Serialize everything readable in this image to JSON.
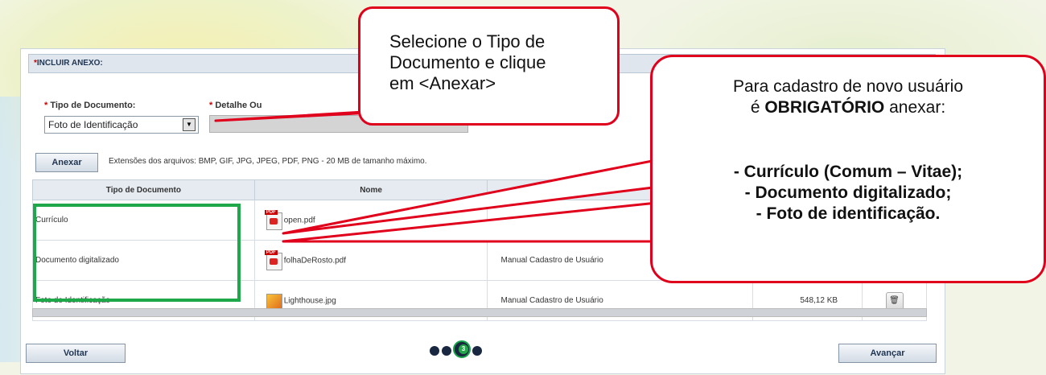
{
  "panel": {
    "title_req": "*",
    "title": "INCLUIR ANEXO:"
  },
  "form": {
    "tipo_label_req": "* ",
    "tipo_label": "Tipo de Documento:",
    "tipo_value": "Foto de Identificação",
    "detalhe_label_req": "* ",
    "detalhe_label": "Detalhe Ou"
  },
  "anexar": {
    "button": "Anexar",
    "extensions": "Extensões dos arquivos: BMP, GIF, JPG, JPEG, PDF, PNG - 20 MB de tamanho máximo."
  },
  "table": {
    "headers": [
      "Tipo de Documento",
      "Nome",
      "",
      "",
      ""
    ],
    "rows": [
      {
        "tipo": "Currículo",
        "nome": "open.pdf",
        "icon": "pdf-icon",
        "descricao": "",
        "tamanho": ""
      },
      {
        "tipo": "Documento digitalizado",
        "nome": "folhaDeRosto.pdf",
        "icon": "pdf-icon",
        "descricao": "Manual Cadastro de Usuário",
        "tamanho": ""
      },
      {
        "tipo": "Foto de Identificação",
        "nome": "Lighthouse.jpg",
        "icon": "image-icon",
        "descricao": "Manual Cadastro de Usuário",
        "tamanho": "548,12 KB"
      }
    ]
  },
  "nav": {
    "voltar": "Voltar",
    "avancar": "Avançar",
    "current_step": "3"
  },
  "callouts": {
    "c1_line1": "Selecione o Tipo de",
    "c1_line2": "Documento e clique",
    "c1_line3": "em <Anexar>",
    "c2_line1": "Para cadastro de novo usuário",
    "c2_line2_pre": "é ",
    "c2_line2_bold": "OBRIGATÓRIO",
    "c2_line2_post": " anexar:",
    "c2_item1": "- Currículo (Comum – Vitae);",
    "c2_item2": "- Documento digitalizado;",
    "c2_item3": "- Foto de identificação."
  },
  "colors": {
    "callout_border": "#e0001b",
    "highlight": "#1ea84a",
    "header_bg": "#dfe6ee"
  }
}
